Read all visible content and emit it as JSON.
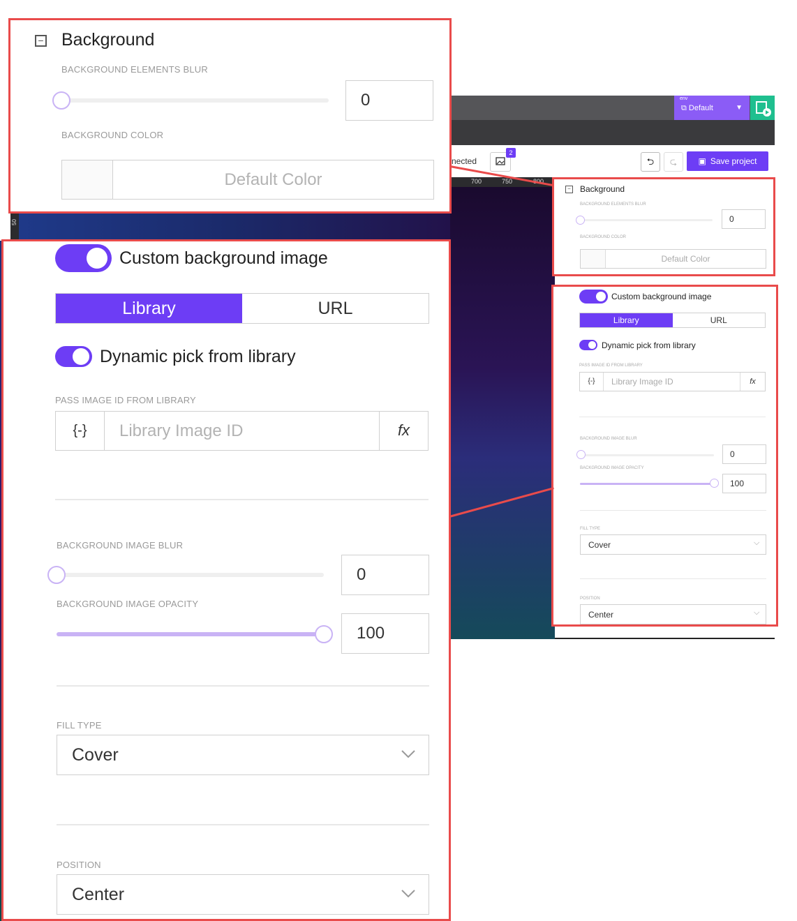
{
  "app": {
    "env_label": "env",
    "env_value": "Default",
    "toolbar_text": "nected",
    "badge_count": "2",
    "save_label": "Save project",
    "ruler_ticks": [
      "700",
      "750",
      "800"
    ],
    "vruler_tick": "50"
  },
  "background": {
    "title": "Background",
    "elements_blur_label": "BACKGROUND ELEMENTS BLUR",
    "elements_blur_value": "0",
    "elements_blur_level": 0,
    "color_label": "BACKGROUND COLOR",
    "color_placeholder": "Default Color"
  },
  "image": {
    "custom_toggle_label": "Custom background image",
    "custom_toggle_on": true,
    "tabs": [
      "Library",
      "URL"
    ],
    "active_tab": "Library",
    "dynamic_toggle_label": "Dynamic pick from library",
    "dynamic_toggle_on": true,
    "pass_id_label": "PASS IMAGE ID FROM LIBRARY",
    "pass_id_prefix": "{-}",
    "pass_id_placeholder": "Library Image ID",
    "fx_label": "fx",
    "image_blur_label": "BACKGROUND IMAGE BLUR",
    "image_blur_value": "0",
    "image_blur_level": 0,
    "image_opacity_label": "BACKGROUND IMAGE OPACITY",
    "image_opacity_value": "100",
    "image_opacity_level": 1.0,
    "fill_type_label": "FILL TYPE",
    "fill_type_value": "Cover",
    "position_label": "POSITION",
    "position_value": "Center"
  },
  "colors": {
    "accent": "#6d3df5",
    "highlight_border": "#e94b4b",
    "slider_fill": "#c9b3f5"
  }
}
